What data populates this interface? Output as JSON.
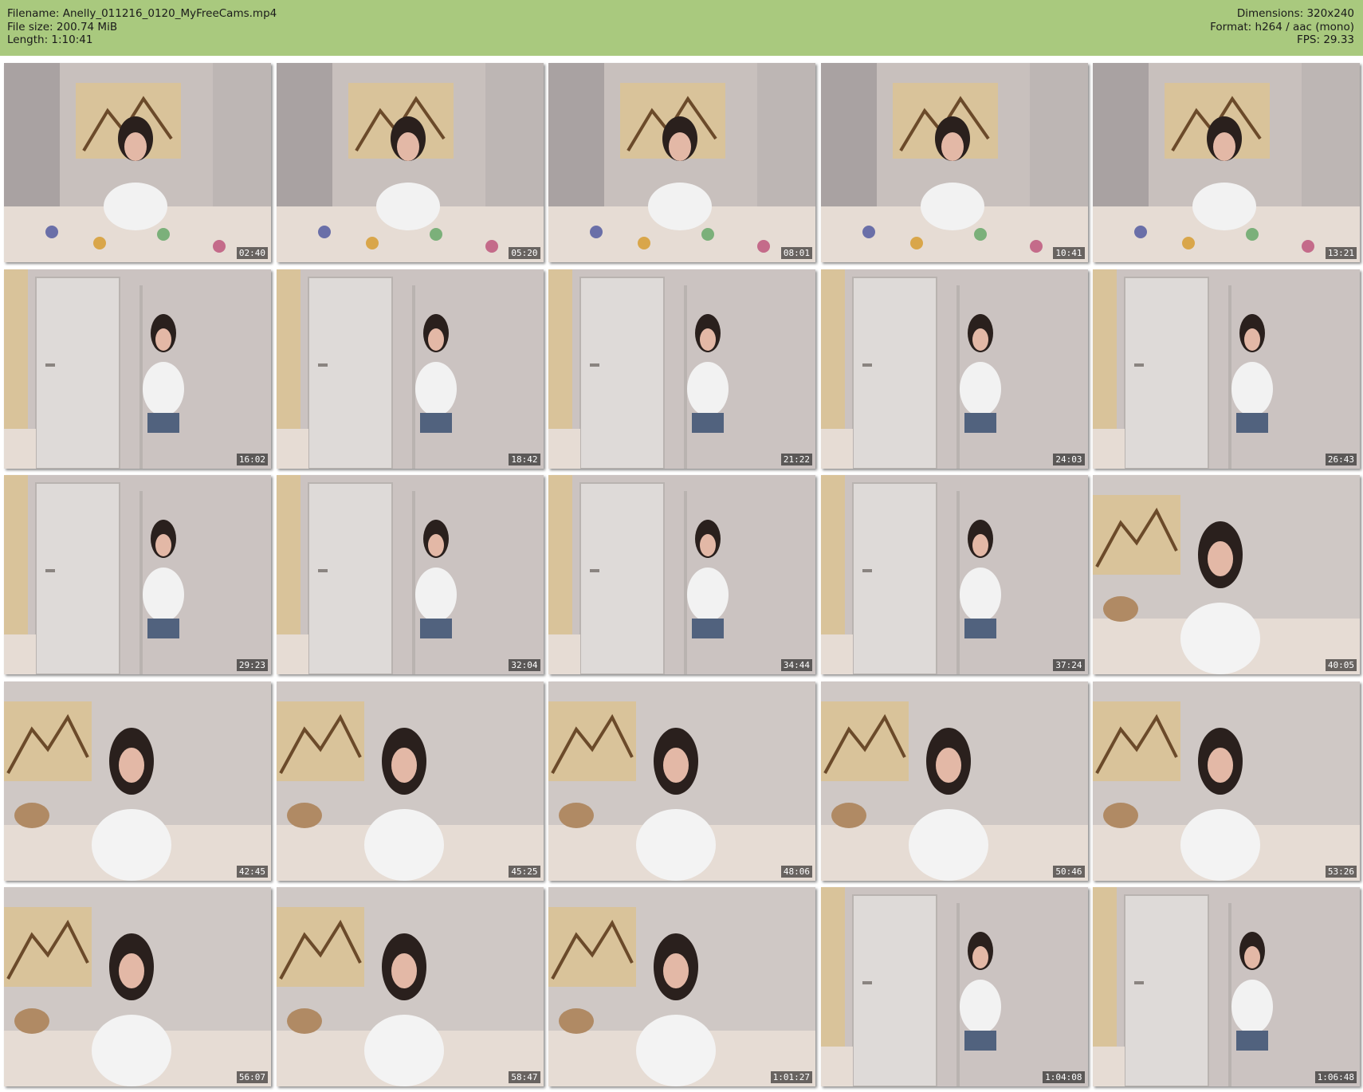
{
  "header": {
    "filename_label": "Filename:",
    "filename": "Anelly_011216_0120_MyFreeCams.mp4",
    "filesize_label": "File size:",
    "filesize": "200.74 MiB",
    "length_label": "Length:",
    "length": "1:10:41",
    "dimensions_label": "Dimensions:",
    "dimensions": "320x240",
    "format_label": "Format:",
    "format": "h264 / aac (mono)",
    "fps_label": "FPS:",
    "fps": "29.33"
  },
  "colors": {
    "header_bg": "#a9c97e",
    "page_bg": "#ffffff"
  },
  "thumbnails": [
    {
      "time": "02:40",
      "scene": "bed"
    },
    {
      "time": "05:20",
      "scene": "bed"
    },
    {
      "time": "08:01",
      "scene": "bed"
    },
    {
      "time": "10:41",
      "scene": "bed"
    },
    {
      "time": "13:21",
      "scene": "bed"
    },
    {
      "time": "16:02",
      "scene": "door"
    },
    {
      "time": "18:42",
      "scene": "door"
    },
    {
      "time": "21:22",
      "scene": "door"
    },
    {
      "time": "24:03",
      "scene": "door"
    },
    {
      "time": "26:43",
      "scene": "door"
    },
    {
      "time": "29:23",
      "scene": "door"
    },
    {
      "time": "32:04",
      "scene": "door"
    },
    {
      "time": "34:44",
      "scene": "door"
    },
    {
      "time": "37:24",
      "scene": "door"
    },
    {
      "time": "40:05",
      "scene": "desk"
    },
    {
      "time": "42:45",
      "scene": "desk"
    },
    {
      "time": "45:25",
      "scene": "desk"
    },
    {
      "time": "48:06",
      "scene": "desk"
    },
    {
      "time": "50:46",
      "scene": "desk"
    },
    {
      "time": "53:26",
      "scene": "desk"
    },
    {
      "time": "56:07",
      "scene": "desk"
    },
    {
      "time": "58:47",
      "scene": "desk"
    },
    {
      "time": "1:01:27",
      "scene": "desk"
    },
    {
      "time": "1:04:08",
      "scene": "door"
    },
    {
      "time": "1:06:48",
      "scene": "door"
    }
  ]
}
